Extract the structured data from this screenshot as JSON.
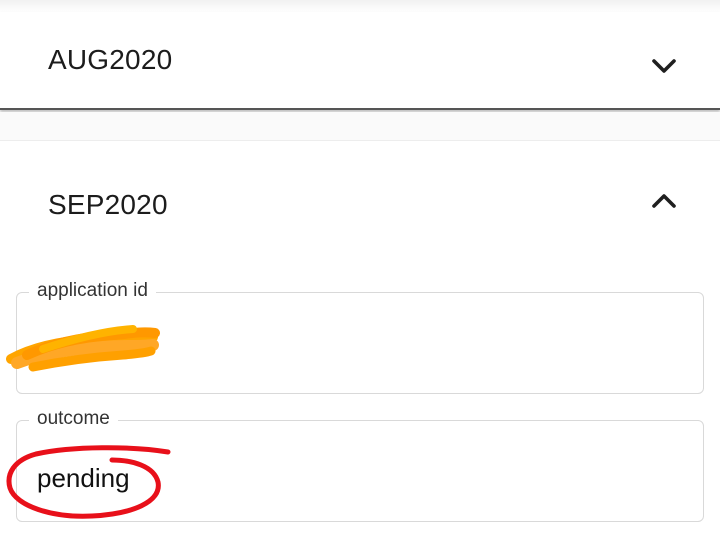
{
  "accordion": {
    "collapsed_panel": {
      "title": "AUG2020",
      "icon": "chevron-down-icon"
    },
    "expanded_panel": {
      "title": "SEP2020",
      "icon": "chevron-up-icon",
      "fields": {
        "application_id": {
          "label": "application id",
          "value": "",
          "redacted": true,
          "redaction_color": "#FFA500"
        },
        "outcome": {
          "label": "outcome",
          "value": "pending",
          "annotation_color": "#E8101A"
        }
      }
    }
  }
}
